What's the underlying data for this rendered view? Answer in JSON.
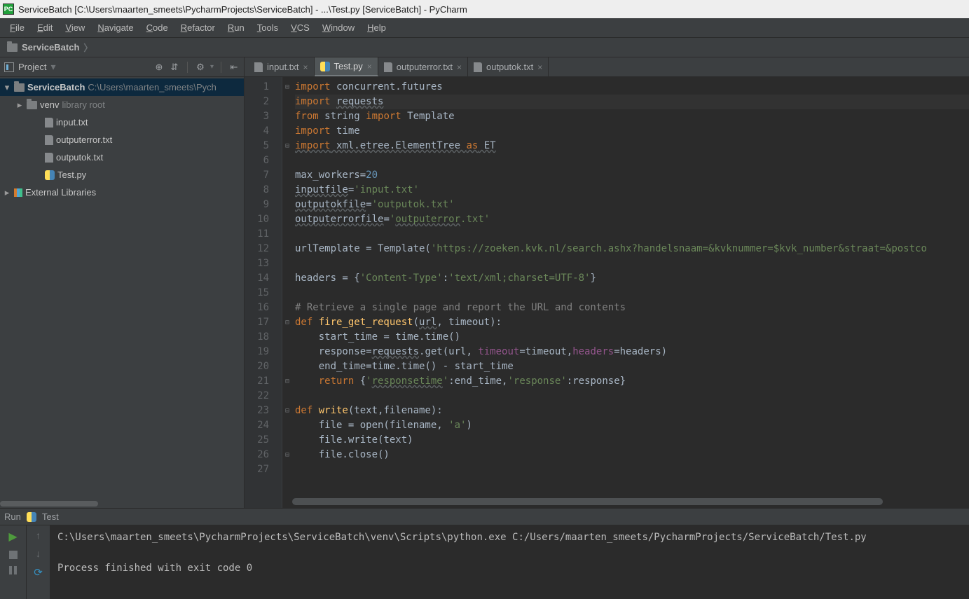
{
  "title": "ServiceBatch [C:\\Users\\maarten_smeets\\PycharmProjects\\ServiceBatch] - ...\\Test.py [ServiceBatch] - PyCharm",
  "app_icon_text": "PC",
  "menu": [
    "File",
    "Edit",
    "View",
    "Navigate",
    "Code",
    "Refactor",
    "Run",
    "Tools",
    "VCS",
    "Window",
    "Help"
  ],
  "breadcrumb": {
    "project": "ServiceBatch"
  },
  "project_panel": {
    "label": "Project",
    "tree": [
      {
        "type": "root",
        "name": "ServiceBatch",
        "path": "C:\\Users\\maarten_smeets\\Pych",
        "selected": true,
        "expanded": true
      },
      {
        "type": "folder",
        "name": "venv",
        "suffix": "library root",
        "indent": 1,
        "expanded": false
      },
      {
        "type": "file",
        "name": "input.txt",
        "icon": "txt",
        "indent": 2
      },
      {
        "type": "file",
        "name": "outputerror.txt",
        "icon": "txt",
        "indent": 2
      },
      {
        "type": "file",
        "name": "outputok.txt",
        "icon": "txt",
        "indent": 2
      },
      {
        "type": "file",
        "name": "Test.py",
        "icon": "py",
        "indent": 2
      },
      {
        "type": "lib",
        "name": "External Libraries",
        "indent": 0,
        "expanded": false
      }
    ]
  },
  "tabs": [
    {
      "name": "input.txt",
      "icon": "txt",
      "active": false
    },
    {
      "name": "Test.py",
      "icon": "py",
      "active": true
    },
    {
      "name": "outputerror.txt",
      "icon": "txt",
      "active": false
    },
    {
      "name": "outputok.txt",
      "icon": "txt",
      "active": false
    }
  ],
  "code_lines": [
    {
      "n": 1,
      "fold": "-",
      "tokens": [
        [
          "kw",
          "import"
        ],
        [
          "",
          " "
        ],
        [
          "",
          "concurrent.futures"
        ]
      ]
    },
    {
      "n": 2,
      "hl": true,
      "tokens": [
        [
          "kw",
          "import"
        ],
        [
          "",
          " "
        ],
        [
          "ul",
          "requests"
        ]
      ]
    },
    {
      "n": 3,
      "tokens": [
        [
          "kw",
          "from"
        ],
        [
          "",
          " "
        ],
        [
          "",
          "string "
        ],
        [
          "kw",
          "import"
        ],
        [
          "",
          " Template"
        ]
      ]
    },
    {
      "n": 4,
      "tokens": [
        [
          "kw",
          "import"
        ],
        [
          "",
          " "
        ],
        [
          "",
          "time"
        ]
      ]
    },
    {
      "n": 5,
      "fold": "-",
      "tokens": [
        [
          "kwul",
          "import"
        ],
        [
          "ul",
          " xml.etree.ElementTree "
        ],
        [
          "kwul",
          "as"
        ],
        [
          "ul",
          " ET"
        ]
      ]
    },
    {
      "n": 6,
      "tokens": [
        [
          "",
          ""
        ]
      ]
    },
    {
      "n": 7,
      "tokens": [
        [
          "",
          "max_workers="
        ],
        [
          "num",
          "20"
        ]
      ]
    },
    {
      "n": 8,
      "tokens": [
        [
          "ul",
          "inputfile"
        ],
        [
          "",
          "="
        ],
        [
          "str",
          "'input.txt'"
        ]
      ]
    },
    {
      "n": 9,
      "tokens": [
        [
          "ul",
          "outputokfile"
        ],
        [
          "",
          "="
        ],
        [
          "str",
          "'outputok.txt'"
        ]
      ]
    },
    {
      "n": 10,
      "tokens": [
        [
          "ul",
          "outputerrorfile"
        ],
        [
          "",
          "="
        ],
        [
          "str",
          "'"
        ],
        [
          "strul",
          "outputerror"
        ],
        [
          "str",
          ".txt'"
        ]
      ]
    },
    {
      "n": 11,
      "tokens": [
        [
          "",
          ""
        ]
      ]
    },
    {
      "n": 12,
      "tokens": [
        [
          "",
          "urlTemplate = Template("
        ],
        [
          "str",
          "'https://zoeken.kvk.nl/search.ashx?handelsnaam=&kvknummer=$kvk_number&straat=&postco"
        ]
      ]
    },
    {
      "n": 13,
      "tokens": [
        [
          "",
          ""
        ]
      ]
    },
    {
      "n": 14,
      "tokens": [
        [
          "",
          "headers = {"
        ],
        [
          "str",
          "'Content-Type'"
        ],
        [
          "",
          ":"
        ],
        [
          "str",
          "'text/xml;charset=UTF-8'"
        ],
        [
          "",
          "}"
        ]
      ]
    },
    {
      "n": 15,
      "tokens": [
        [
          "",
          ""
        ]
      ]
    },
    {
      "n": 16,
      "tokens": [
        [
          "cmt",
          "# Retrieve a single page and report the URL and contents"
        ]
      ]
    },
    {
      "n": 17,
      "fold": "-",
      "tokens": [
        [
          "kw",
          "def "
        ],
        [
          "fn",
          "fire_get_request"
        ],
        [
          "",
          "("
        ],
        [
          "ul",
          "url"
        ],
        [
          "",
          ", timeout):"
        ]
      ]
    },
    {
      "n": 18,
      "tokens": [
        [
          "",
          "    start_time = time.time()"
        ]
      ]
    },
    {
      "n": 19,
      "tokens": [
        [
          "",
          "    response="
        ],
        [
          "ul",
          "requests"
        ],
        [
          "",
          ".get(url, "
        ],
        [
          "self",
          "timeout"
        ],
        [
          "",
          "=timeout,"
        ],
        [
          "self",
          "headers"
        ],
        [
          "",
          "=headers)"
        ]
      ]
    },
    {
      "n": 20,
      "tokens": [
        [
          "",
          "    end_time=time.time() - start_time"
        ]
      ]
    },
    {
      "n": 21,
      "fold": "-",
      "tokens": [
        [
          "",
          "    "
        ],
        [
          "kw",
          "return"
        ],
        [
          "",
          " {"
        ],
        [
          "str",
          "'"
        ],
        [
          "strul",
          "responsetime"
        ],
        [
          "str",
          "'"
        ],
        [
          "",
          ":end_time,"
        ],
        [
          "str",
          "'response'"
        ],
        [
          "",
          ":response}"
        ]
      ]
    },
    {
      "n": 22,
      "tokens": [
        [
          "",
          ""
        ]
      ]
    },
    {
      "n": 23,
      "fold": "-",
      "tokens": [
        [
          "kw",
          "def "
        ],
        [
          "fn",
          "write"
        ],
        [
          "",
          "(text,filename):"
        ]
      ]
    },
    {
      "n": 24,
      "tokens": [
        [
          "",
          "    file = "
        ],
        [
          "",
          "open(filename, "
        ],
        [
          "str",
          "'a'"
        ],
        [
          "",
          ")"
        ]
      ]
    },
    {
      "n": 25,
      "tokens": [
        [
          "",
          "    file.write(text)"
        ]
      ]
    },
    {
      "n": 26,
      "fold": "-",
      "tokens": [
        [
          "",
          "    file.close()"
        ]
      ]
    },
    {
      "n": 27,
      "tokens": [
        [
          "",
          ""
        ]
      ]
    }
  ],
  "run": {
    "header_label": "Run",
    "config_name": "Test",
    "console_lines": [
      "C:\\Users\\maarten_smeets\\PycharmProjects\\ServiceBatch\\venv\\Scripts\\python.exe C:/Users/maarten_smeets/PycharmProjects/ServiceBatch/Test.py",
      "",
      "Process finished with exit code 0"
    ]
  }
}
